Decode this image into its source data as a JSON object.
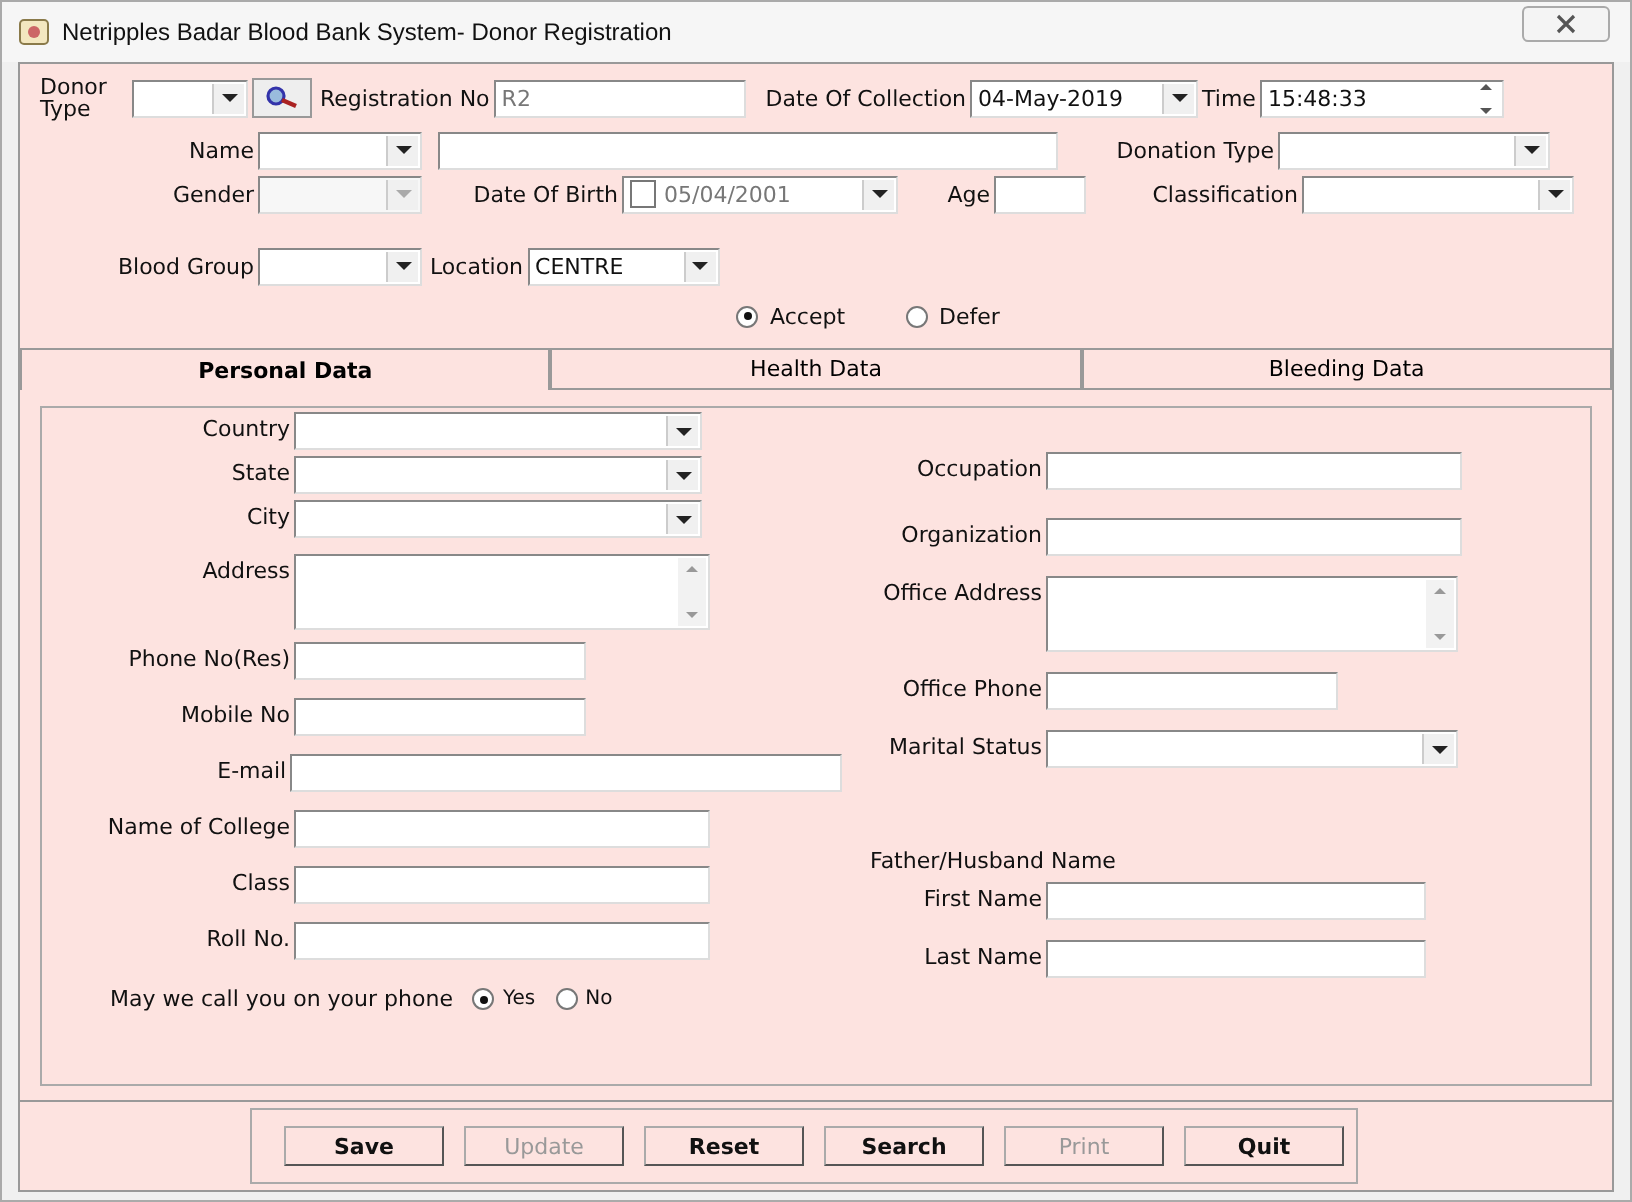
{
  "window": {
    "title": "Netripples Badar Blood Bank System- Donor Registration"
  },
  "header": {
    "donor_type": {
      "label": "Donor Type"
    },
    "registration_no": {
      "label": "Registration No",
      "value": "R2"
    },
    "date_of_collection": {
      "label": "Date Of Collection",
      "value": "04-May-2019"
    },
    "time": {
      "label": "Time",
      "value": "15:48:33"
    },
    "name": {
      "label": "Name"
    },
    "donation_type": {
      "label": "Donation Type"
    },
    "gender": {
      "label": "Gender",
      "disabled": true
    },
    "date_of_birth": {
      "label": "Date Of Birth",
      "checked": false,
      "value": "05/04/2001"
    },
    "age": {
      "label": "Age"
    },
    "classification": {
      "label": "Classification"
    },
    "blood_group": {
      "label": "Blood Group"
    },
    "location": {
      "label": "Location",
      "value": "CENTRE"
    },
    "decision": [
      {
        "label": "Accept",
        "selected": true
      },
      {
        "label": "Defer",
        "selected": false
      }
    ]
  },
  "tabs": [
    {
      "label": "Personal Data",
      "selected": true
    },
    {
      "label": "Health Data",
      "selected": false
    },
    {
      "label": "Bleeding Data",
      "selected": false
    }
  ],
  "personal_left": [
    {
      "kind": "combo",
      "label": "Country"
    },
    {
      "kind": "combo",
      "label": "State"
    },
    {
      "kind": "combo",
      "label": "City"
    },
    {
      "kind": "textarea",
      "label": "Address"
    },
    {
      "kind": "short",
      "label": "Phone No(Res)"
    },
    {
      "kind": "short",
      "label": "Mobile No"
    },
    {
      "kind": "long",
      "label": "E-mail"
    },
    {
      "kind": "medium",
      "label": "Name of College"
    },
    {
      "kind": "medium",
      "label": "Class"
    },
    {
      "kind": "medium",
      "label": "Roll No."
    }
  ],
  "call_phone": {
    "label": "May we call you on your phone",
    "options": [
      {
        "label": "Yes",
        "selected": true
      },
      {
        "label": "No",
        "selected": false
      }
    ]
  },
  "personal_right": [
    {
      "kind": "medium",
      "label": "Occupation"
    },
    {
      "kind": "medium",
      "label": "Organization"
    },
    {
      "kind": "textarea",
      "label": "Office Address"
    },
    {
      "kind": "short",
      "label": "Office Phone"
    },
    {
      "kind": "combo",
      "label": "Marital Status"
    },
    {
      "kind": "heading",
      "label": "Father/Husband Name"
    },
    {
      "kind": "name",
      "label": "First Name"
    },
    {
      "kind": "name",
      "label": "Last Name"
    }
  ],
  "buttons": [
    {
      "label": "Save",
      "disabled": false
    },
    {
      "label": "Update",
      "disabled": true
    },
    {
      "label": "Reset",
      "disabled": false
    },
    {
      "label": "Search",
      "disabled": false
    },
    {
      "label": "Print",
      "disabled": true
    },
    {
      "label": "Quit",
      "disabled": false
    }
  ]
}
